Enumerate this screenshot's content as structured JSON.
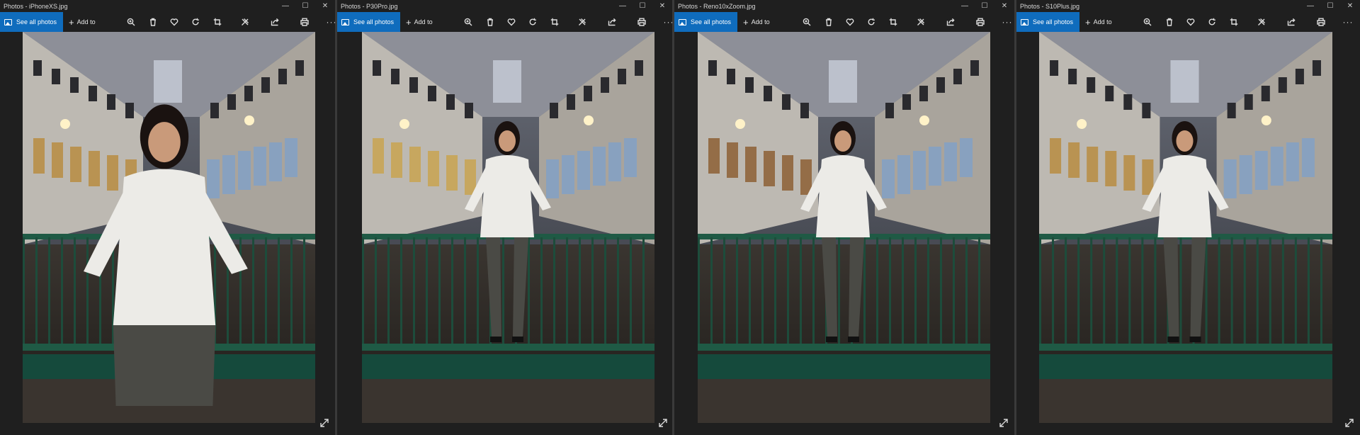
{
  "windows": [
    {
      "title": "Photos - iPhoneXS.jpg",
      "see_all": "See all photos",
      "add_to": "Add to"
    },
    {
      "title": "Photos - P30Pro.jpg",
      "see_all": "See all photos",
      "add_to": "Add to"
    },
    {
      "title": "Photos - Reno10xZoom.jpg",
      "see_all": "See all photos",
      "add_to": "Add to"
    },
    {
      "title": "Photos - S10Plus.jpg",
      "see_all": "See all photos",
      "add_to": "Add to"
    }
  ],
  "window_controls": {
    "minimize": "—",
    "maximize": "☐",
    "close": "✕"
  },
  "toolbar_icons": [
    "zoom-icon",
    "delete-icon",
    "heart-icon",
    "rotate-icon",
    "crop-icon",
    "edit-icon",
    "share-icon",
    "print-icon",
    "more-icon"
  ],
  "colors": {
    "accent": "#0f6cbd",
    "background": "#1f1f1f",
    "separator": "#3a3a3a"
  }
}
